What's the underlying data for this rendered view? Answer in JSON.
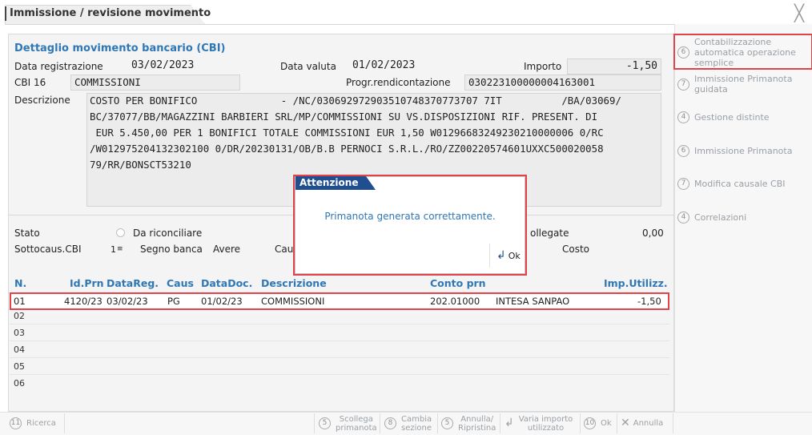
{
  "window": {
    "title": "Immissione / revisione movimento",
    "close_glyph": "╳"
  },
  "detail": {
    "section_title": "Dettaglio movimento bancario (CBI)",
    "data_registrazione_label": "Data registrazione",
    "data_registrazione": "03/02/2023",
    "data_valuta_label": "Data valuta",
    "data_valuta": "01/02/2023",
    "importo_label": "Importo",
    "importo": "-1,50",
    "cbi_label": "CBI",
    "cbi_code": "16",
    "cbi_desc": "COMMISSIONI",
    "progr_label": "Progr.rendicontazione",
    "progr_value": "030223100000004163001",
    "descrizione_label": "Descrizione",
    "descrizione_text": "COSTO PER BONIFICO              - /NC/030692972903510748370773707 7IT          /BA/03069/\nBC/37077/BB/MAGAZZINI BARBIERI SRL/MP/COMMISSIONI SU VS.DISPOSIZIONI RIF. PRESENT. DI\n EUR 5.450,00 PER 1 BONIFICI TOTALE COMMISSIONI EUR 1,50 W01296683249230210000006 0/RC\n/W012975204132302100 0/DR/20230131/OB/B.B PERNOCI S.R.L./RO/ZZ00220574601UXXC500020058\n79/RR/BONSCT53210"
  },
  "status": {
    "stato_label": "Stato",
    "stato_value": "Da riconciliare",
    "sottocaus_label": "Sottocaus.CBI",
    "sottocaus_value": "1",
    "segno_label": "Segno banca",
    "segno_value": "Avere",
    "caus_label_partial": "Cau",
    "collegate_label_partial": "ollegate",
    "collegate_value": "0,00",
    "costo_label": "Costo"
  },
  "table": {
    "headers": {
      "n": "N.",
      "idprn": "Id.Prn",
      "datareg": "DataReg.",
      "caus": "Caus",
      "datadoc": "DataDoc.",
      "descrizione": "Descrizione",
      "conto": "Conto prn",
      "imp": "Imp.Utilizz."
    },
    "row1": {
      "n": "01",
      "idprn": "4120/23",
      "datareg": "03/02/23",
      "caus": "PG",
      "datadoc": "01/02/23",
      "descrizione": "COMMISSIONI",
      "conto": "202.01000",
      "conto_desc": "INTESA SANPAO",
      "imp": "-1,50"
    },
    "empty_rows": [
      "02",
      "03",
      "04",
      "05",
      "06"
    ]
  },
  "dialog": {
    "title": "Attenzione",
    "message": "Primanota generata correttamente.",
    "ok_label": "Ok"
  },
  "side_menu": [
    {
      "num": "6",
      "label": "Contabilizzazione automatica operazione semplice"
    },
    {
      "num": "7",
      "label": "Immissione Primanota guidata"
    },
    {
      "num": "4",
      "label": "Gestione distinte"
    },
    {
      "num": "6",
      "label": "Immissione Primanota"
    },
    {
      "num": "7",
      "label": "Modifica causale CBI"
    },
    {
      "num": "4",
      "label": "Correlazioni"
    }
  ],
  "bottom_bar": {
    "ricerca": {
      "num": "11",
      "label": "Ricerca"
    },
    "scollega": {
      "num": "5",
      "label1": "Scollega",
      "label2": "primanota"
    },
    "cambia": {
      "num": "8",
      "label1": "Cambia",
      "label2": "sezione"
    },
    "annulla_ripristina": {
      "num": "5",
      "label1": "Annulla/",
      "label2": "Ripristina"
    },
    "varia": {
      "label1": "Varia importo",
      "label2": "utilizzato"
    },
    "ok": {
      "num": "10",
      "label": "Ok"
    },
    "annulla": {
      "label": "Annulla"
    }
  },
  "colors": {
    "accent_blue": "#2f78b5",
    "dialog_header": "#1f4f8f",
    "highlight_red": "#e0444a"
  }
}
